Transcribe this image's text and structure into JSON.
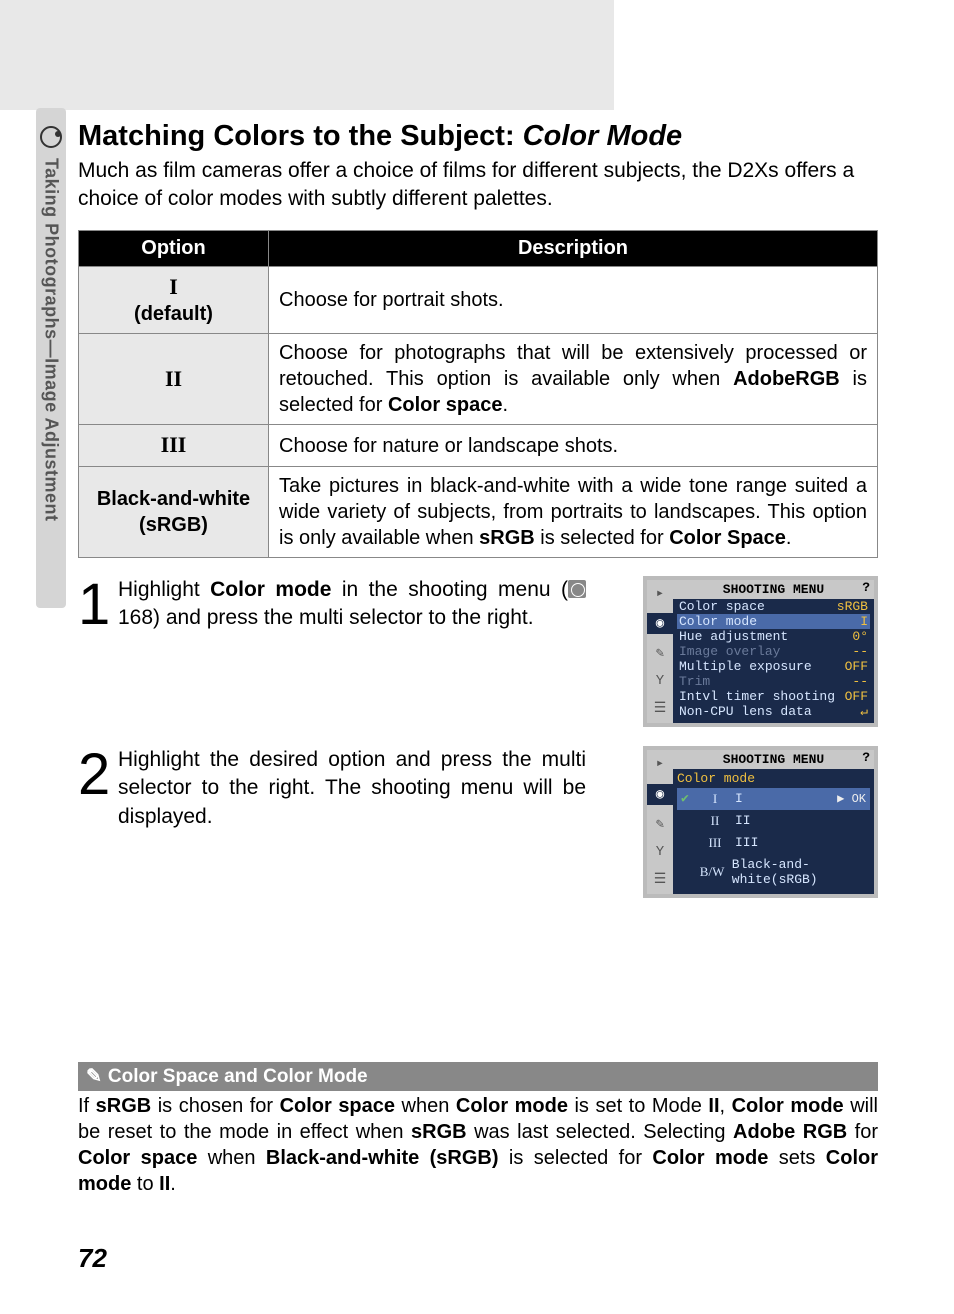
{
  "side_label": "Taking Photographs—Image Adjustment",
  "heading_plain": "Matching Colors to the Subject: ",
  "heading_ital": "Color Mode",
  "intro": "Much as film cameras offer a choice of films for different subjects, the D2Xs offers a choice of color modes with subtly different palettes.",
  "table": {
    "head_option": "Option",
    "head_desc": "Description",
    "rows": [
      {
        "opt_html": "<span class='roman'>I</span><br>(default)",
        "desc": "Choose for portrait shots."
      },
      {
        "opt_html": "<span class='roman'>II</span>",
        "desc": "Choose for photographs that will be extensively processed or retouched.  This option is available only when <b>AdobeRGB</b> is selected for <b>Color space</b>."
      },
      {
        "opt_html": "<span class='roman'>III</span>",
        "desc": "Choose for nature or landscape shots."
      },
      {
        "opt_html": "Black-and-white<br>(sRGB)",
        "desc": "Take pictures in black-and-white with a wide tone range suited a wide variety of subjects, from portraits to landscapes.  This option is only available when <b>sRGB</b> is selected for <b>Color Space</b>."
      }
    ]
  },
  "steps": [
    {
      "num": "1",
      "text": "Highlight <b>Color mode</b> in the shooting menu (<span class='pageref-icon' data-name='page-ref-icon' data-interactable='false'></span> 168) and press the multi selector to the right."
    },
    {
      "num": "2",
      "text": "Highlight the desired option and press the multi selector to the right.  The shooting menu will be displayed."
    }
  ],
  "screen1": {
    "title": "SHOOTING MENU",
    "rows": [
      {
        "label": "Color space",
        "val": "sRGB",
        "cls": ""
      },
      {
        "label": "Color mode",
        "val": "I",
        "cls": "hl"
      },
      {
        "label": "Hue adjustment",
        "val": "0°",
        "cls": ""
      },
      {
        "label": "Image overlay",
        "val": "--",
        "cls": "dim"
      },
      {
        "label": "Multiple exposure",
        "val": "OFF",
        "cls": ""
      },
      {
        "label": "Trim",
        "val": "--",
        "cls": "dim"
      },
      {
        "label": "Intvl timer shooting",
        "val": "OFF",
        "cls": ""
      },
      {
        "label": "Non-CPU lens data",
        "val": "↵",
        "cls": ""
      }
    ]
  },
  "screen2": {
    "title": "SHOOTING MENU",
    "sub": "Color mode",
    "opts": [
      {
        "chk": "✔",
        "rm": "I",
        "lab": "I",
        "sel": true,
        "ok": "▶ OK"
      },
      {
        "chk": "",
        "rm": "II",
        "lab": "II",
        "sel": false,
        "ok": ""
      },
      {
        "chk": "",
        "rm": "III",
        "lab": "III",
        "sel": false,
        "ok": ""
      },
      {
        "chk": "",
        "rm": "B/W",
        "lab": "Black-and-white(sRGB)",
        "sel": false,
        "ok": ""
      }
    ]
  },
  "note_head": "Color Space and Color Mode",
  "note_body": "If <b>sRGB</b> is chosen for <b>Color space</b> when <b>Color mode</b> is set to Mode <b>II</b>, <b>Color mode</b> will be reset to the mode in effect when <b>sRGB</b> was last selected.  Selecting <b>Adobe RGB</b> for <b>Color space</b> when <b>Black-and-white (sRGB)</b> is selected for <b>Color mode</b> sets <b>Color mode</b> to <b>II</b>.",
  "page_number": "72"
}
